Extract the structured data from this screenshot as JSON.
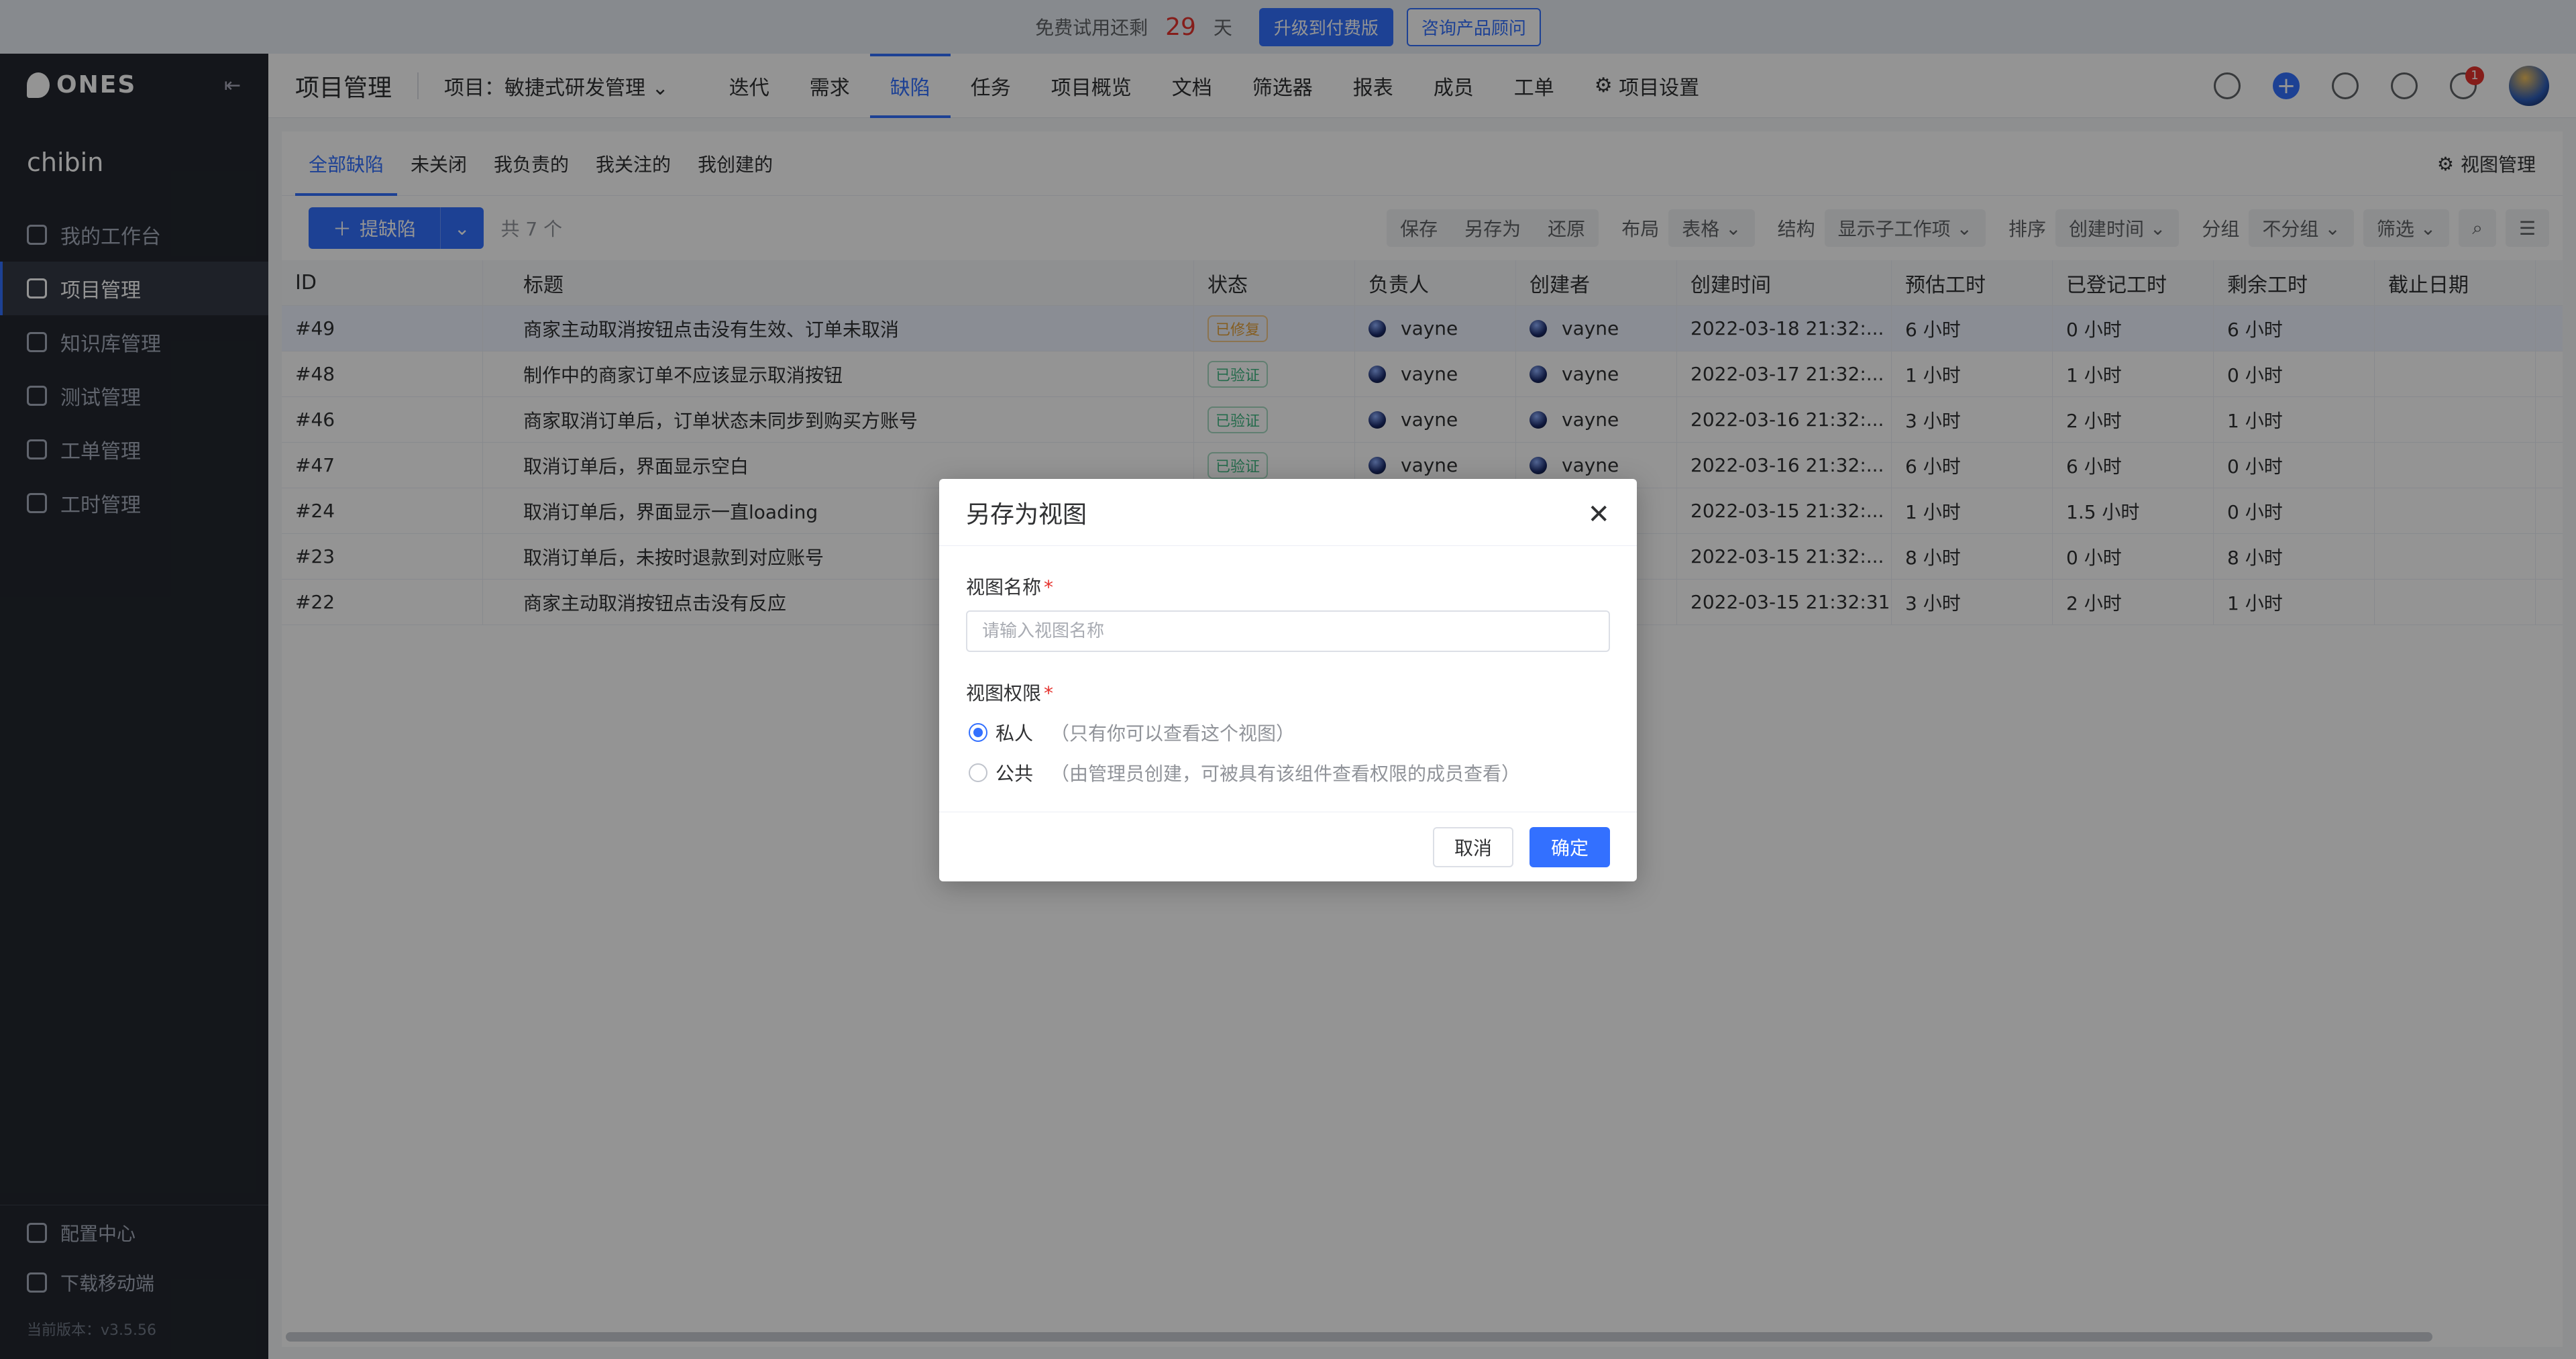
{
  "trial": {
    "prefix": "免费试用还剩",
    "days": "29",
    "suffix": "天",
    "upgrade_label": "升级到付费版",
    "consult_label": "咨询产品顾问"
  },
  "sidebar": {
    "logo": "ONES",
    "team": "chibin",
    "items": [
      {
        "label": "我的工作台"
      },
      {
        "label": "项目管理"
      },
      {
        "label": "知识库管理"
      },
      {
        "label": "测试管理"
      },
      {
        "label": "工单管理"
      },
      {
        "label": "工时管理"
      }
    ],
    "footer": [
      {
        "label": "配置中心"
      },
      {
        "label": "下载移动端"
      }
    ],
    "version": "当前版本：v3.5.56"
  },
  "header": {
    "module": "项目管理",
    "project": "项目：敏捷式研发管理",
    "tabs": [
      "迭代",
      "需求",
      "缺陷",
      "任务",
      "项目概览",
      "文档",
      "筛选器",
      "报表",
      "成员",
      "工单",
      "项目设置"
    ],
    "notification_count": "1"
  },
  "subtabs": [
    "全部缺陷",
    "未关闭",
    "我负责的",
    "我关注的",
    "我创建的"
  ],
  "view_manage": "视图管理",
  "toolbar": {
    "add_label": "提缺陷",
    "count": "共 7 个",
    "save": "保存",
    "save_as": "另存为",
    "restore": "还原",
    "layout_label": "布局",
    "layout_value": "表格",
    "structure_label": "结构",
    "structure_value": "显示子工作项",
    "sort_label": "排序",
    "sort_value": "创建时间",
    "group_label": "分组",
    "group_value": "不分组",
    "filter_label": "筛选"
  },
  "table": {
    "headers": [
      "ID",
      "标题",
      "状态",
      "负责人",
      "创建者",
      "创建时间",
      "预估工时",
      "已登记工时",
      "剩余工时",
      "截止日期"
    ],
    "rows": [
      {
        "id": "#49",
        "title": "商家主动取消按钮点击没有生效、订单未取消",
        "status": "已修复",
        "owner": "vayne",
        "creator": "vayne",
        "time": "2022-03-18 21:32:...",
        "est": "6 小时",
        "log": "0 小时",
        "rem": "6 小时"
      },
      {
        "id": "#48",
        "title": "制作中的商家订单不应该显示取消按钮",
        "status": "已验证",
        "owner": "vayne",
        "creator": "vayne",
        "time": "2022-03-17 21:32:...",
        "est": "1 小时",
        "log": "1 小时",
        "rem": "0 小时"
      },
      {
        "id": "#46",
        "title": "商家取消订单后，订单状态未同步到购买方账号",
        "status": "已验证",
        "owner": "vayne",
        "creator": "vayne",
        "time": "2022-03-16 21:32:...",
        "est": "3 小时",
        "log": "2 小时",
        "rem": "1 小时"
      },
      {
        "id": "#47",
        "title": "取消订单后，界面显示空白",
        "status": "已验证",
        "owner": "vayne",
        "creator": "vayne",
        "time": "2022-03-16 21:32:...",
        "est": "6 小时",
        "log": "6 小时",
        "rem": "0 小时"
      },
      {
        "id": "#24",
        "title": "取消订单后，界面显示一直loading",
        "status": "",
        "owner": "",
        "creator": "",
        "time": "2022-03-15 21:32:...",
        "est": "1 小时",
        "log": "1.5 小时",
        "rem": "0 小时"
      },
      {
        "id": "#23",
        "title": "取消订单后，未按时退款到对应账号",
        "status": "",
        "owner": "",
        "creator": "",
        "time": "2022-03-15 21:32:...",
        "est": "8 小时",
        "log": "0 小时",
        "rem": "8 小时"
      },
      {
        "id": "#22",
        "title": "商家主动取消按钮点击没有反应",
        "status": "",
        "owner": "",
        "creator": "",
        "time": "2022-03-15 21:32:31",
        "est": "3 小时",
        "log": "2 小时",
        "rem": "1 小时"
      }
    ]
  },
  "modal": {
    "title": "另存为视图",
    "name_label": "视图名称",
    "name_placeholder": "请输入视图名称",
    "perm_label": "视图权限",
    "private_label": "私人",
    "private_hint": "（只有你可以查看这个视图）",
    "public_label": "公共",
    "public_hint": "（由管理员创建，可被具有该组件查看权限的成员查看）",
    "cancel": "取消",
    "ok": "确定"
  },
  "colors": {
    "accent": "#3370ff",
    "sidebar_bg": "#23272f",
    "danger": "#e5322d"
  }
}
